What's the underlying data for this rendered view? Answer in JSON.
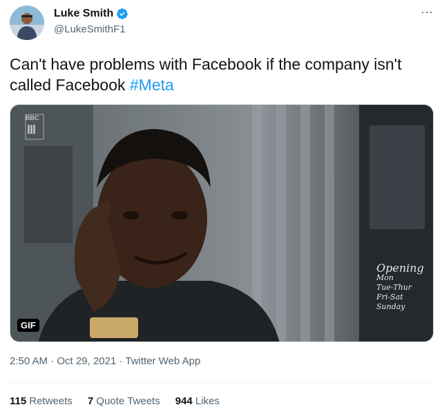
{
  "author": {
    "display_name": "Luke Smith",
    "handle": "@LukeSmithF1",
    "avatar_icon": "profile-avatar",
    "verified_icon": "verified-badge-icon",
    "verified_color": "#1d9bf0"
  },
  "more_label": "···",
  "tweet": {
    "text_before": "Can't have problems with Facebook if the company isn't called Facebook ",
    "hashtag": "#Meta",
    "hashtag_color": "#1d9bf0"
  },
  "media": {
    "gif_badge": "GIF",
    "channel_logo": "BBC",
    "channel_number": "III",
    "sign_lines": [
      "Opening",
      "Mon",
      "Tue-Thur",
      "Fri-Sat",
      "Sunday"
    ]
  },
  "meta": {
    "time": "2:50 AM",
    "separator": "·",
    "date": "Oct 29, 2021",
    "app": "Twitter Web App"
  },
  "stats": {
    "retweets_count": "115",
    "retweets_label": "Retweets",
    "quotes_count": "7",
    "quotes_label": "Quote Tweets",
    "likes_count": "944",
    "likes_label": "Likes"
  }
}
